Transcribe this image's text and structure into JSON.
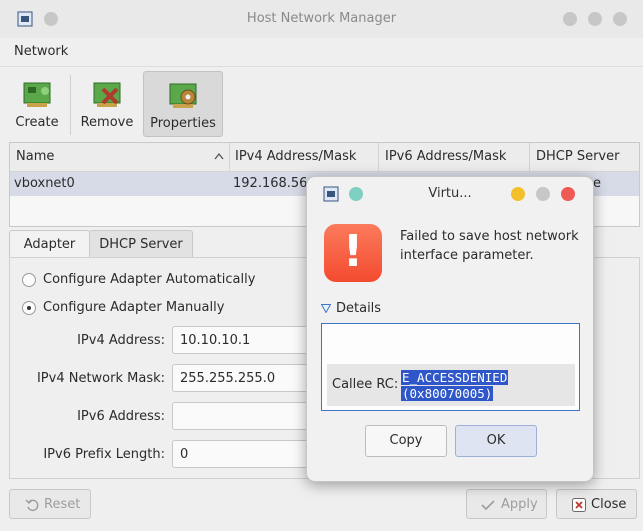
{
  "window": {
    "title": "Host Network Manager"
  },
  "menubar": {
    "network": "Network"
  },
  "toolbar": {
    "create": "Create",
    "remove": "Remove",
    "properties": "Properties"
  },
  "table": {
    "headers": [
      "Name",
      "IPv4 Address/Mask",
      "IPv6 Address/Mask",
      "DHCP Server"
    ],
    "rows": [
      {
        "name": "vboxnet0",
        "ipv4": "192.168.56.1",
        "ipv6": "",
        "dhcp": "e"
      }
    ]
  },
  "tabs": {
    "adapter": "Adapter",
    "dhcp": "DHCP Server"
  },
  "adapter": {
    "auto_label": "Configure Adapter Automatically",
    "manual_label": "Configure Adapter Manually",
    "ipv4_address_label": "IPv4 Address:",
    "ipv4_address_value": "10.10.10.1",
    "ipv4_mask_label": "IPv4 Network Mask:",
    "ipv4_mask_value": "255.255.255.0",
    "ipv6_address_label": "IPv6 Address:",
    "ipv6_address_value": "",
    "ipv6_prefix_label": "IPv6 Prefix Length:",
    "ipv6_prefix_value": "0"
  },
  "buttons": {
    "reset": "Reset",
    "apply": "Apply",
    "close": "Close"
  },
  "dialog": {
    "title": "Virtu...",
    "message": "Failed to save host network interface parameter.",
    "details_label": "Details",
    "callee_label": "Callee RC:",
    "callee_code": "E_ACCESSDENIED",
    "callee_hex": "(0x80070005)",
    "copy": "Copy",
    "ok": "OK",
    "icon_glyph": "!"
  },
  "colors": {
    "accent": "#3d76c8",
    "warning": "#f44b2f",
    "selection": "#d7dbe7",
    "dlg_close": "#ef5a54",
    "dlg_min": "#f3c02b"
  }
}
